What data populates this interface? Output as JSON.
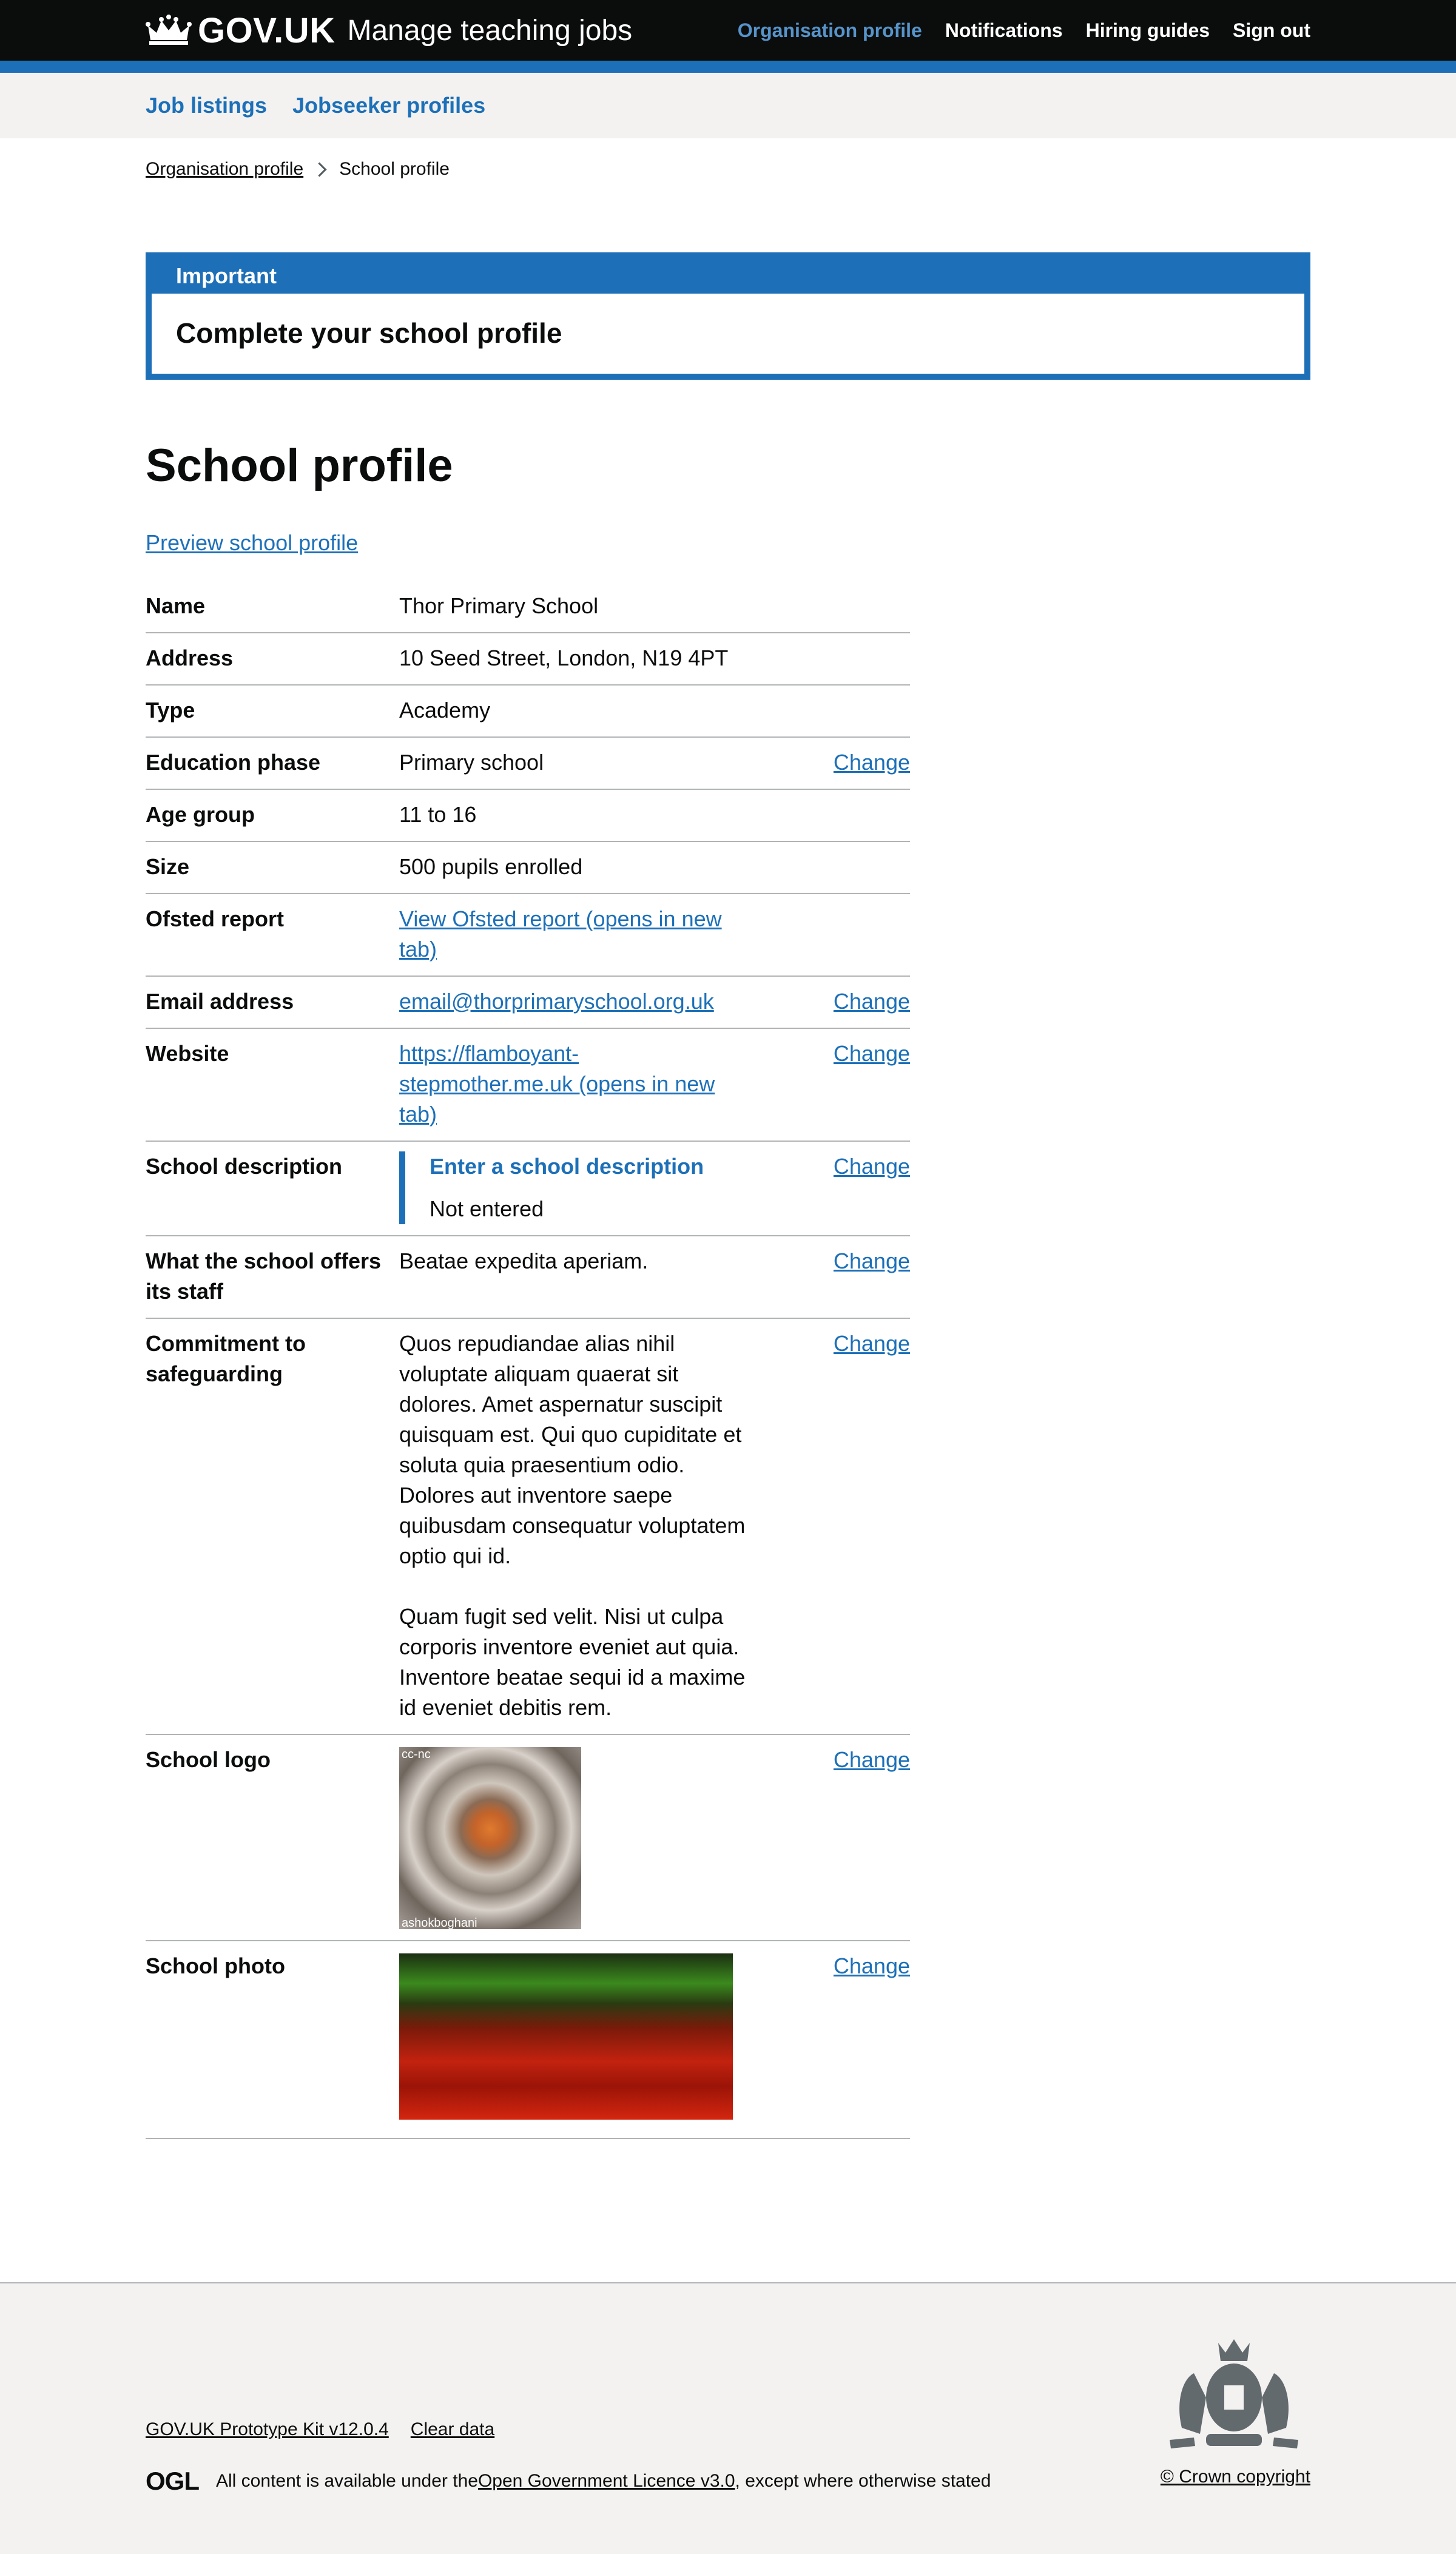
{
  "header": {
    "brand": "GOV.UK",
    "service": "Manage teaching jobs",
    "nav": [
      "Organisation profile",
      "Notifications",
      "Hiring guides",
      "Sign out"
    ]
  },
  "subnav": [
    "Job listings",
    "Jobseeker profiles"
  ],
  "breadcrumb": [
    "Organisation profile",
    "School profile"
  ],
  "banner": {
    "title": "Important",
    "content": "Complete your school profile"
  },
  "page_title": "School profile",
  "preview_link": "Preview school profile",
  "change_label": "Change",
  "summary": {
    "name": {
      "key": "Name",
      "value": "Thor Primary School"
    },
    "address": {
      "key": "Address",
      "value": "10 Seed Street, London, N19 4PT"
    },
    "type": {
      "key": "Type",
      "value": "Academy"
    },
    "phase": {
      "key": "Education phase",
      "value": "Primary school"
    },
    "age": {
      "key": "Age group",
      "value": "11 to 16"
    },
    "size": {
      "key": "Size",
      "value": "500 pupils enrolled"
    },
    "ofsted": {
      "key": "Ofsted report",
      "value": "View Ofsted report (opens in new tab)"
    },
    "email": {
      "key": "Email address",
      "value": "email@thorprimaryschool.org.uk"
    },
    "website": {
      "key": "Website",
      "value": "https://flamboyant-stepmother.me.uk (opens in new tab)"
    },
    "description": {
      "key": "School description",
      "inset_title": "Enter a school description",
      "inset_text": "Not entered"
    },
    "offers": {
      "key": "What the school offers its staff",
      "value": "Beatae expedita aperiam."
    },
    "safeguarding": {
      "key": "Commitment to safeguarding",
      "p1": "Quos repudiandae alias nihil voluptate aliquam quaerat sit dolores. Amet aspernatur suscipit quisquam est. Qui quo cupiditate et soluta quia praesentium odio. Dolores aut inventore saepe quibusdam consequatur voluptatem optio qui id.",
      "p2": "Quam fugit sed velit. Nisi ut culpa corporis inventore eveniet aut quia. Inventore beatae sequi id a maxime id eveniet debitis rem."
    },
    "logo": {
      "key": "School logo",
      "caption_top": "cc-nc",
      "caption_bottom": "ashokboghani"
    },
    "photo": {
      "key": "School photo"
    }
  },
  "footer": {
    "links": [
      "GOV.UK Prototype Kit v12.0.4",
      "Clear data"
    ],
    "ogl": "OGL",
    "licence_before": "All content is available under the ",
    "licence_link": "Open Government Licence v3.0",
    "licence_after": ", except where otherwise stated",
    "copyright": "© Crown copyright"
  }
}
